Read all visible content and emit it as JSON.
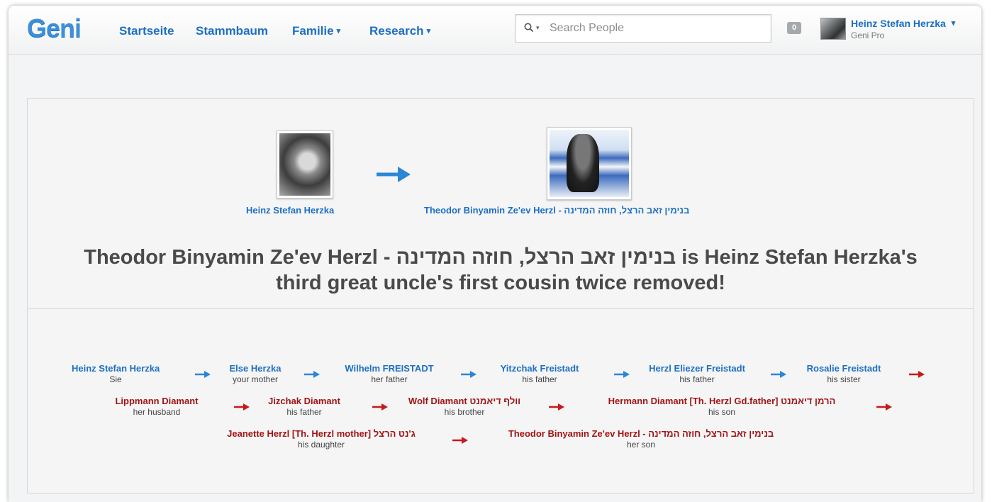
{
  "header": {
    "logo": "Geni",
    "nav": [
      {
        "label": "Startseite"
      },
      {
        "label": "Stammbaum"
      },
      {
        "label": "Familie",
        "caret": "▾"
      },
      {
        "label": "Research",
        "caret": "▾"
      }
    ],
    "search_placeholder": "Search People",
    "notification_count": "0",
    "user": {
      "name": "Heinz Stefan Herzka",
      "caret": "▾",
      "role": "Geni Pro"
    }
  },
  "comparison": {
    "from_name": "Heinz Stefan Herzka",
    "to_name": "Theodor Binyamin Ze'ev Herzl - בנימין זאב הרצל, חוזה המדינה",
    "headline_line1": "Theodor Binyamin Ze'ev Herzl - בנימין זאב הרצל, חוזה המדינה is Heinz Stefan Herzka's",
    "headline_line2": "third great uncle's first cousin twice removed!"
  },
  "path": [
    {
      "name": "Heinz Stefan Herzka",
      "relation": "Sie"
    },
    {
      "name": "Else Herzka",
      "relation": "your mother"
    },
    {
      "name": "Wilhelm FREISTADT",
      "relation": "her father"
    },
    {
      "name": "Yitzchak Freistadt",
      "relation": "his father"
    },
    {
      "name": "Herzl Eliezer Freistadt",
      "relation": "his father"
    },
    {
      "name": "Rosalie Freistadt",
      "relation": "his sister"
    },
    {
      "name": "Lippmann Diamant",
      "relation": "her husband"
    },
    {
      "name": "Jizchak Diamant",
      "relation": "his father"
    },
    {
      "name": "Wolf Diamant וולף דיאמנט",
      "relation": "his brother"
    },
    {
      "name": "Hermann Diamant [Th. Herzl Gd.father] הרמן דיאמנט",
      "relation": "his son"
    },
    {
      "name": "Jeanette Herzl [Th. Herzl mother] ג'נט הרצל",
      "relation": "his daughter"
    },
    {
      "name": "Theodor Binyamin Ze'ev Herzl - בנימין זאב הרצל, חוזה המדינה",
      "relation": "her son"
    }
  ],
  "colors": {
    "link_blue": "#1d6fc2",
    "link_red": "#a11414",
    "arrow_blue": "#2b86d6",
    "arrow_red": "#c8191a"
  }
}
